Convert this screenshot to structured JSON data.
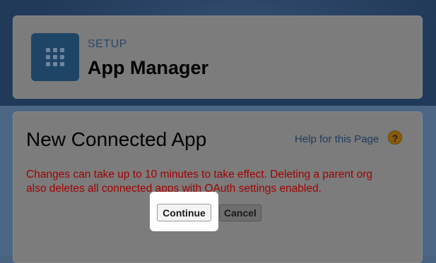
{
  "header": {
    "setup_label": "SETUP",
    "title": "App Manager",
    "icon": "app-grid-icon"
  },
  "content": {
    "title": "New Connected App",
    "help_link": "Help for this Page",
    "help_icon": "?",
    "warning_line1": "Changes can take up to 10 minutes to take effect. Deleting a parent org",
    "warning_line2": "also deletes all connected apps with OAuth settings enabled.",
    "warning_color": "#a30000"
  },
  "buttons": {
    "continue_label": "Continue",
    "cancel_label": "Cancel"
  }
}
